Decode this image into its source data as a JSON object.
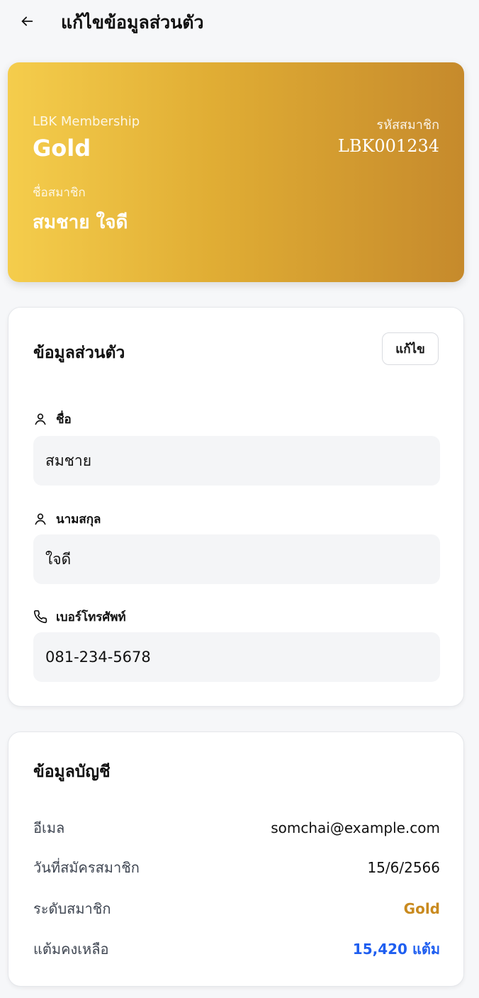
{
  "header": {
    "title": "แก้ไขข้อมูลส่วนตัว"
  },
  "member_card": {
    "brand": "LBK Membership",
    "tier": "Gold",
    "name_label": "ชื่อสมาชิก",
    "name": "สมชาย ใจดี",
    "id_label": "รหัสสมาชิก",
    "id": "LBK001234"
  },
  "personal": {
    "title": "ข้อมูลส่วนตัว",
    "edit_label": "แก้ไข",
    "fields": [
      {
        "label": "ชื่อ",
        "value": "สมชาย",
        "icon": "user-icon"
      },
      {
        "label": "นามสกุล",
        "value": "ใจดี",
        "icon": "user-icon"
      },
      {
        "label": "เบอร์โทรศัพท์",
        "value": "081-234-5678",
        "icon": "phone-icon"
      }
    ]
  },
  "account": {
    "title": "ข้อมูลบัญชี",
    "rows": [
      {
        "label": "อีเมล",
        "value": "somchai@example.com"
      },
      {
        "label": "วันที่สมัครสมาชิก",
        "value": "15/6/2566"
      },
      {
        "label": "ระดับสมาชิก",
        "value": "Gold"
      },
      {
        "label": "แต้มคงเหลือ",
        "value": "15,420 แต้ม"
      }
    ]
  },
  "colors": {
    "gold_start": "#f5cd4c",
    "gold_end": "#c68a2c",
    "tier_text": "#c98a1f",
    "points_text": "#1e5ef0"
  }
}
